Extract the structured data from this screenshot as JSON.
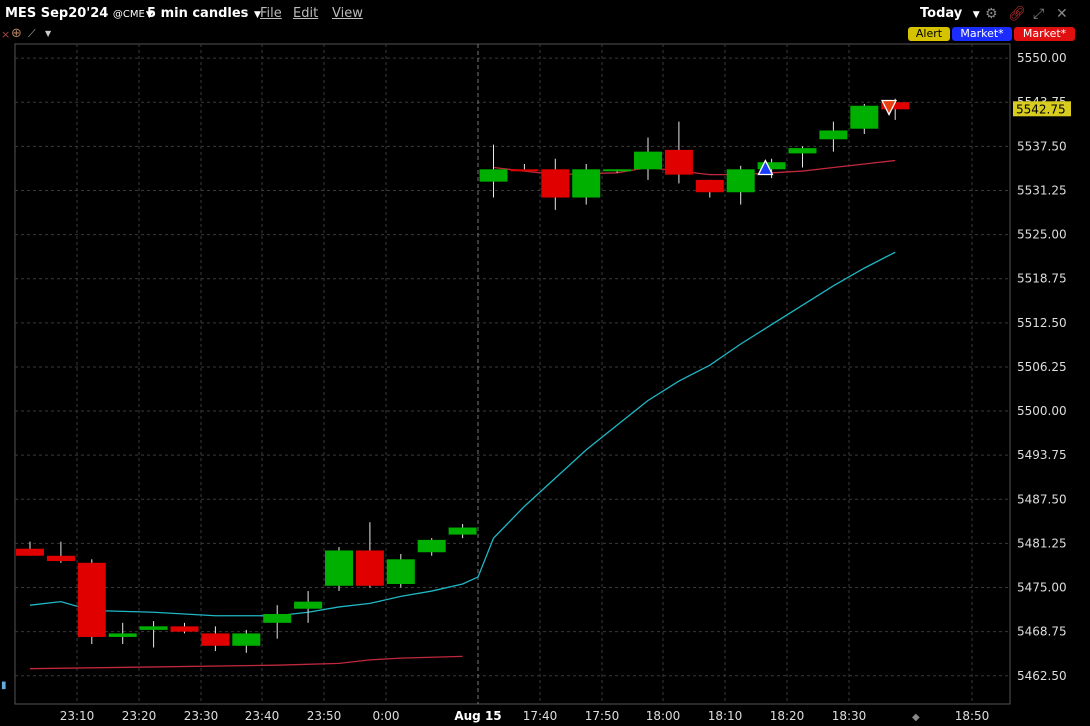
{
  "header": {
    "symbol": "MES Sep20'24",
    "exchange": "@CME",
    "candle_interval": "5 min candles",
    "menu": [
      "File",
      "Edit",
      "View"
    ],
    "range": "Today"
  },
  "order_buttons": {
    "alert": "Alert",
    "buy": "Market*",
    "sell": "Market*"
  },
  "colors": {
    "up": "#00b000",
    "down": "#e00000",
    "ma_short": "#c0283c",
    "ma_long_cyan": "#20b6c4",
    "grid": "#3a3a3a",
    "price_badge": "#d8cc20"
  },
  "icons": [
    "close-icon",
    "crosshair-icon",
    "drawing-tools-icon",
    "settings-gear-icon",
    "link-icon",
    "expand-icon",
    "close-window-icon"
  ],
  "chart_data": {
    "type": "candlestick",
    "y_ticks": [
      "5550.00",
      "5543.75",
      "5537.50",
      "5531.25",
      "5525.00",
      "5518.75",
      "5512.50",
      "5506.25",
      "5500.00",
      "5493.75",
      "5487.50",
      "5481.25",
      "5475.00",
      "5468.75",
      "5462.50"
    ],
    "x_ticks": [
      "23:10",
      "23:20",
      "23:30",
      "23:40",
      "23:50",
      "0:00",
      "Aug 15",
      "17:40",
      "17:50",
      "18:00",
      "18:10",
      "18:20",
      "18:30",
      "18:50"
    ],
    "ylim": [
      5458.5,
      5552.0
    ],
    "last_price": "5542.75",
    "session_break": "Aug 15",
    "candles": [
      {
        "o": 5480.5,
        "h": 5481.5,
        "l": 5479.5,
        "c": 5479.5
      },
      {
        "o": 5479.5,
        "h": 5481.5,
        "l": 5478.5,
        "c": 5478.75
      },
      {
        "o": 5478.5,
        "h": 5479.0,
        "l": 5467.0,
        "c": 5468.0
      },
      {
        "o": 5468.0,
        "h": 5470.0,
        "l": 5467.0,
        "c": 5468.5
      },
      {
        "o": 5469.0,
        "h": 5470.25,
        "l": 5466.5,
        "c": 5469.5
      },
      {
        "o": 5469.5,
        "h": 5470.0,
        "l": 5468.5,
        "c": 5468.75
      },
      {
        "o": 5468.5,
        "h": 5469.5,
        "l": 5466.0,
        "c": 5466.75
      },
      {
        "o": 5466.75,
        "h": 5469.0,
        "l": 5465.75,
        "c": 5468.5
      },
      {
        "o": 5470.0,
        "h": 5472.5,
        "l": 5467.75,
        "c": 5471.25
      },
      {
        "o": 5472.0,
        "h": 5474.5,
        "l": 5470.0,
        "c": 5473.0
      },
      {
        "o": 5475.25,
        "h": 5480.75,
        "l": 5474.5,
        "c": 5480.25
      },
      {
        "o": 5480.25,
        "h": 5484.25,
        "l": 5475.0,
        "c": 5475.25
      },
      {
        "o": 5475.5,
        "h": 5479.75,
        "l": 5475.0,
        "c": 5479.0
      },
      {
        "o": 5480.0,
        "h": 5482.0,
        "l": 5479.5,
        "c": 5481.75
      },
      {
        "o": 5482.5,
        "h": 5484.0,
        "l": 5482.0,
        "c": 5483.5
      },
      {
        "o": 5532.5,
        "h": 5537.75,
        "l": 5530.25,
        "c": 5534.25
      },
      {
        "o": 5534.25,
        "h": 5535.0,
        "l": 5534.0,
        "c": 5534.0
      },
      {
        "o": 5534.25,
        "h": 5535.75,
        "l": 5528.5,
        "c": 5530.25
      },
      {
        "o": 5530.25,
        "h": 5535.0,
        "l": 5529.25,
        "c": 5534.25
      },
      {
        "o": 5534.0,
        "h": 5534.25,
        "l": 5533.75,
        "c": 5534.25
      },
      {
        "o": 5534.25,
        "h": 5538.75,
        "l": 5532.75,
        "c": 5536.75
      },
      {
        "o": 5537.0,
        "h": 5541.0,
        "l": 5532.25,
        "c": 5533.5
      },
      {
        "o": 5532.75,
        "h": 5532.75,
        "l": 5530.25,
        "c": 5531.0
      },
      {
        "o": 5531.0,
        "h": 5534.75,
        "l": 5529.25,
        "c": 5534.25
      },
      {
        "o": 5534.25,
        "h": 5535.75,
        "l": 5533.0,
        "c": 5535.25
      },
      {
        "o": 5536.5,
        "h": 5537.5,
        "l": 5534.5,
        "c": 5537.25
      },
      {
        "o": 5538.5,
        "h": 5541.0,
        "l": 5536.75,
        "c": 5539.75
      },
      {
        "o": 5540.0,
        "h": 5543.5,
        "l": 5539.25,
        "c": 5543.25
      },
      {
        "o": 5543.75,
        "h": 5544.25,
        "l": 5541.25,
        "c": 5542.75
      }
    ],
    "ma_short": [
      {
        "i": 0,
        "v": 5463.5
      },
      {
        "i": 4,
        "v": 5463.75
      },
      {
        "i": 8,
        "v": 5464.0
      },
      {
        "i": 10,
        "v": 5464.25
      },
      {
        "i": 11,
        "v": 5464.75
      },
      {
        "i": 12,
        "v": 5465.0
      },
      {
        "i": 14,
        "v": 5465.25
      },
      {
        "i": 15,
        "v": 5534.5
      },
      {
        "i": 17,
        "v": 5533.5
      },
      {
        "i": 19,
        "v": 5533.75
      },
      {
        "i": 20,
        "v": 5534.5
      },
      {
        "i": 21,
        "v": 5534.0
      },
      {
        "i": 22,
        "v": 5533.5
      },
      {
        "i": 23,
        "v": 5533.5
      },
      {
        "i": 24,
        "v": 5533.75
      },
      {
        "i": 25,
        "v": 5534.0
      },
      {
        "i": 26,
        "v": 5534.5
      },
      {
        "i": 27,
        "v": 5535.0
      },
      {
        "i": 28,
        "v": 5535.5
      }
    ],
    "ma_long": [
      {
        "i": 0,
        "v": 5472.5
      },
      {
        "i": 1,
        "v": 5473.0
      },
      {
        "i": 2,
        "v": 5471.75
      },
      {
        "i": 4,
        "v": 5471.5
      },
      {
        "i": 6,
        "v": 5471.0
      },
      {
        "i": 8,
        "v": 5471.0
      },
      {
        "i": 9,
        "v": 5471.5
      },
      {
        "i": 10,
        "v": 5472.25
      },
      {
        "i": 11,
        "v": 5472.75
      },
      {
        "i": 12,
        "v": 5473.75
      },
      {
        "i": 13,
        "v": 5474.5
      },
      {
        "i": 14,
        "v": 5475.5
      },
      {
        "i": 14.5,
        "v": 5476.5
      },
      {
        "i": 15,
        "v": 5482.0
      },
      {
        "i": 16,
        "v": 5486.5
      },
      {
        "i": 17,
        "v": 5490.5
      },
      {
        "i": 18,
        "v": 5494.5
      },
      {
        "i": 19,
        "v": 5498.0
      },
      {
        "i": 20,
        "v": 5501.5
      },
      {
        "i": 21,
        "v": 5504.25
      },
      {
        "i": 22,
        "v": 5506.5
      },
      {
        "i": 23,
        "v": 5509.5
      },
      {
        "i": 24,
        "v": 5512.25
      },
      {
        "i": 25,
        "v": 5515.0
      },
      {
        "i": 26,
        "v": 5517.75
      },
      {
        "i": 27,
        "v": 5520.25
      },
      {
        "i": 28,
        "v": 5522.5
      }
    ],
    "markers": [
      {
        "type": "buy",
        "i": 23.8,
        "v": 5534.5
      },
      {
        "type": "sell",
        "i": 27.8,
        "v": 5543.0
      }
    ]
  }
}
